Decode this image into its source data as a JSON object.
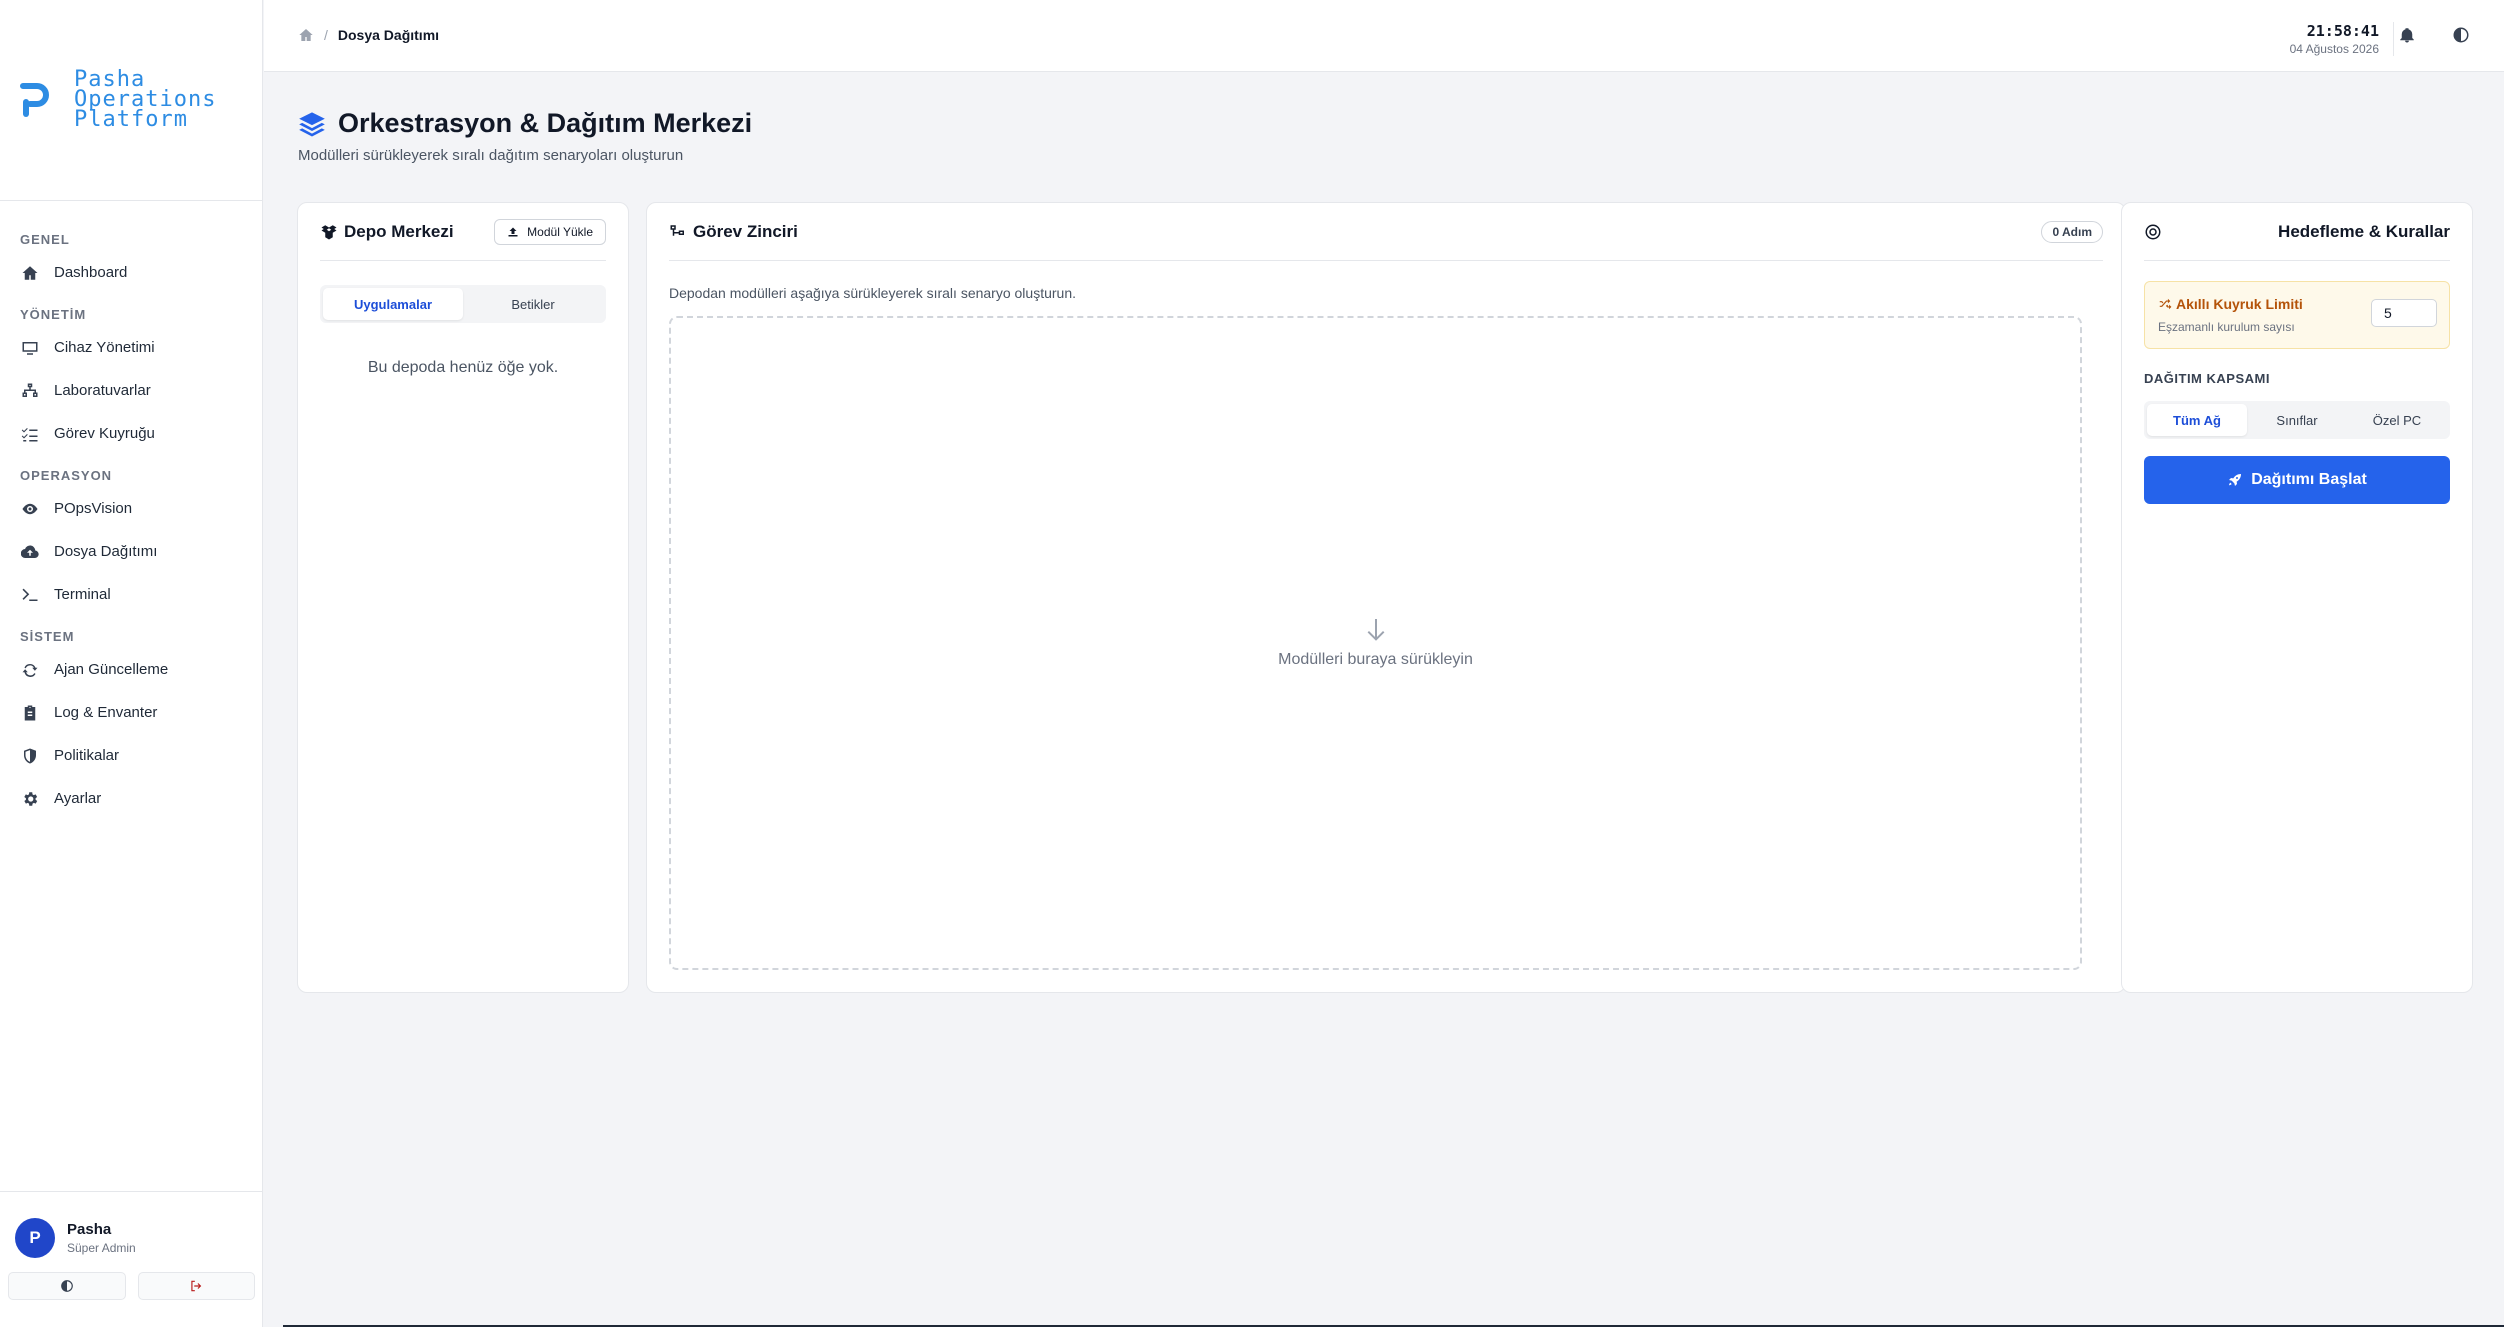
{
  "brand": {
    "lines": [
      "Pasha",
      "Operations",
      "Platform"
    ]
  },
  "sidebar": {
    "sections": [
      {
        "title": "GENEL",
        "items": [
          {
            "label": "Dashboard",
            "icon": "home-icon"
          }
        ]
      },
      {
        "title": "YÖNETİM",
        "items": [
          {
            "label": "Cihaz Yönetimi",
            "icon": "monitor-icon"
          },
          {
            "label": "Laboratuvarlar",
            "icon": "network-icon"
          },
          {
            "label": "Görev Kuyruğu",
            "icon": "list-check-icon"
          }
        ]
      },
      {
        "title": "OPERASYON",
        "items": [
          {
            "label": "POpsVision",
            "icon": "eye-icon"
          },
          {
            "label": "Dosya Dağıtımı",
            "icon": "cloud-upload-icon"
          },
          {
            "label": "Terminal",
            "icon": "terminal-icon"
          }
        ]
      },
      {
        "title": "SİSTEM",
        "items": [
          {
            "label": "Ajan Güncelleme",
            "icon": "sync-icon"
          },
          {
            "label": "Log & Envanter",
            "icon": "clipboard-icon"
          },
          {
            "label": "Politikalar",
            "icon": "shield-icon"
          },
          {
            "label": "Ayarlar",
            "icon": "gear-icon"
          }
        ]
      }
    ],
    "user": {
      "initial": "P",
      "name": "Pasha",
      "role": "Süper Admin"
    }
  },
  "topbar": {
    "breadcrumb": {
      "separator": "/",
      "current": "Dosya Dağıtımı"
    },
    "time": "21:58:41",
    "date": "04 Ağustos 2026"
  },
  "page": {
    "title": "Orkestrasyon & Dağıtım Merkezi",
    "subtitle": "Modülleri sürükleyerek sıralı dağıtım senaryoları oluşturun"
  },
  "repo": {
    "title": "Depo Merkezi",
    "upload_label": "Modül Yükle",
    "tabs": [
      {
        "label": "Uygulamalar",
        "active": true
      },
      {
        "label": "Betikler",
        "active": false
      }
    ],
    "empty": "Bu depoda henüz öğe yok."
  },
  "chain": {
    "title": "Görev Zinciri",
    "step_count": "0 Adım",
    "hint": "Depodan modülleri aşağıya sürükleyerek sıralı senaryo oluşturun.",
    "drop_text": "Modülleri buraya sürükleyin"
  },
  "targeting": {
    "title": "Hedefleme & Kurallar",
    "limit_title": "Akıllı Kuyruk Limiti",
    "limit_sub": "Eşzamanlı kurulum sayısı",
    "limit_value": "5",
    "scope_label": "DAĞITIM KAPSAMI",
    "scope_options": [
      {
        "label": "Tüm Ağ",
        "active": true
      },
      {
        "label": "Sınıflar",
        "active": false
      },
      {
        "label": "Özel PC",
        "active": false
      }
    ],
    "start_label": "Dağıtımı Başlat"
  },
  "colors": {
    "accent": "#2563eb",
    "brand": "#2d8ce3",
    "warning": "#b45309"
  }
}
